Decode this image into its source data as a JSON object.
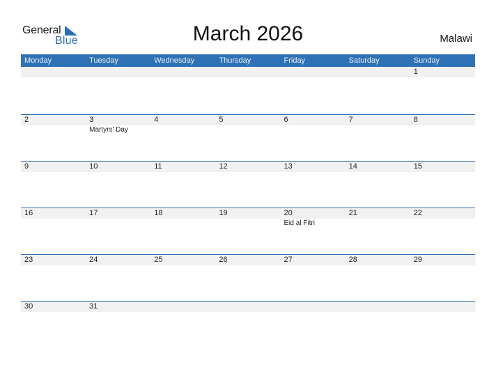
{
  "brand": {
    "word1": "General",
    "word2": "Blue",
    "accent": "#2e72b5"
  },
  "header": {
    "title": "March 2026",
    "country": "Malawi"
  },
  "weekdays": [
    "Monday",
    "Tuesday",
    "Wednesday",
    "Thursday",
    "Friday",
    "Saturday",
    "Sunday"
  ],
  "weeks": [
    [
      {
        "day": ""
      },
      {
        "day": ""
      },
      {
        "day": ""
      },
      {
        "day": ""
      },
      {
        "day": ""
      },
      {
        "day": ""
      },
      {
        "day": "1"
      }
    ],
    [
      {
        "day": "2"
      },
      {
        "day": "3",
        "holiday": "Martyrs' Day"
      },
      {
        "day": "4"
      },
      {
        "day": "5"
      },
      {
        "day": "6"
      },
      {
        "day": "7"
      },
      {
        "day": "8"
      }
    ],
    [
      {
        "day": "9"
      },
      {
        "day": "10"
      },
      {
        "day": "11"
      },
      {
        "day": "12"
      },
      {
        "day": "13"
      },
      {
        "day": "14"
      },
      {
        "day": "15"
      }
    ],
    [
      {
        "day": "16"
      },
      {
        "day": "17"
      },
      {
        "day": "18"
      },
      {
        "day": "19"
      },
      {
        "day": "20",
        "holiday": "Eid al Fitri"
      },
      {
        "day": "21"
      },
      {
        "day": "22"
      }
    ],
    [
      {
        "day": "23"
      },
      {
        "day": "24"
      },
      {
        "day": "25"
      },
      {
        "day": "26"
      },
      {
        "day": "27"
      },
      {
        "day": "28"
      },
      {
        "day": "29"
      }
    ],
    [
      {
        "day": "30"
      },
      {
        "day": "31"
      },
      {
        "day": ""
      },
      {
        "day": ""
      },
      {
        "day": ""
      },
      {
        "day": ""
      },
      {
        "day": ""
      }
    ]
  ]
}
